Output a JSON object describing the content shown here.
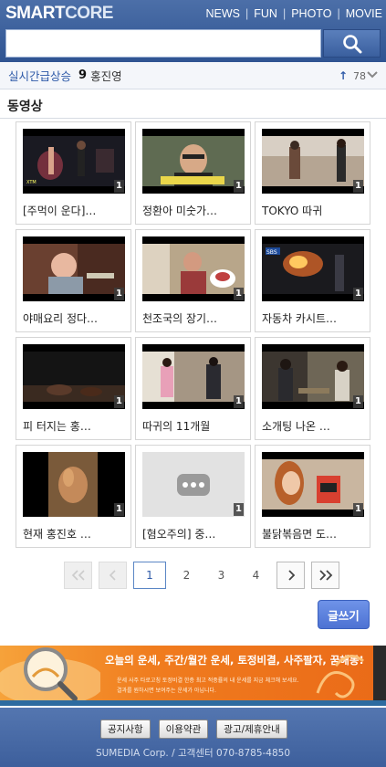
{
  "header": {
    "logo_smart": "SMART",
    "logo_core": "CORE",
    "nav": [
      "NEWS",
      "FUN",
      "PHOTO",
      "MOVIE"
    ],
    "search_placeholder": ""
  },
  "realtime": {
    "label": "실시간급상승",
    "rank": "9",
    "keyword": "홍진영",
    "count": "78"
  },
  "section": {
    "title": "동영상"
  },
  "videos": [
    {
      "caption": "[주먹이 운다]…",
      "count": "1"
    },
    {
      "caption": "정환아 미숫가…",
      "count": "1"
    },
    {
      "caption": "TOKYO 따귀",
      "count": "1"
    },
    {
      "caption": "야매요리 정다…",
      "count": "1"
    },
    {
      "caption": "천조국의 장기…",
      "count": "1"
    },
    {
      "caption": "자동차 카시트…",
      "count": "1"
    },
    {
      "caption": "피 터지는 홍…",
      "count": "1"
    },
    {
      "caption": "따귀의 11개월",
      "count": "1"
    },
    {
      "caption": "소개팅 나온 …",
      "count": "1"
    },
    {
      "caption": "현재 홍진호 …",
      "count": "1"
    },
    {
      "caption": "[혐오주의] 중…",
      "count": "1"
    },
    {
      "caption": "불닭볶음면 도…",
      "count": "1"
    }
  ],
  "pagination": {
    "pages": [
      "1",
      "2",
      "3",
      "4"
    ],
    "current": "1"
  },
  "write_button": "글쓰기",
  "banner": {
    "line1": "오늘의 운세, 주간/월간 운세, 토정비결, 사주팔자, 꿈해몽!",
    "line2": "운세 사주 타로고칭 토정비결 한층 최고 적중률의 내 운세를 지금 체크해 보세요.",
    "line3": "결과를 원하시면 보여주는 운세가 아닙니다."
  },
  "footer": {
    "links": [
      "공지사항",
      "이용약관",
      "광고/제휴안내"
    ],
    "copyright": "SUMEDIA Corp. / 고객센터 070-8785-4850"
  },
  "colors": {
    "header": "#3a5f9e",
    "accent": "#2e5aa8",
    "banner": "#f07c1e",
    "write_button": "#5a80e0"
  }
}
